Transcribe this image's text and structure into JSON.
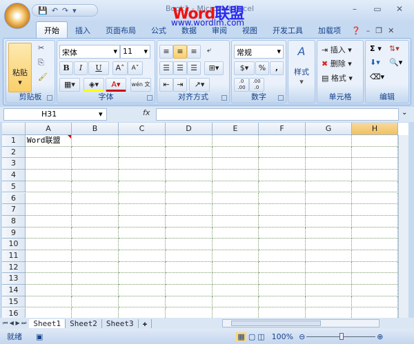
{
  "window": {
    "title": "Book1 - Microsoft Excel",
    "watermark_brand": "Word",
    "watermark_brand_cn": "联盟",
    "watermark_url": "www.wordlm.com"
  },
  "qat": {
    "save": "💾",
    "undo": "↶",
    "redo": "↷",
    "customize": "▾"
  },
  "tabs": [
    "开始",
    "插入",
    "页面布局",
    "公式",
    "数据",
    "审阅",
    "视图",
    "开发工具",
    "加载项"
  ],
  "ribbon": {
    "clipboard": {
      "label": "剪贴板",
      "paste": "粘贴"
    },
    "font": {
      "label": "字体",
      "name": "宋体",
      "size": "11",
      "bold": "B",
      "italic": "I",
      "underline": "U",
      "grow": "A˄",
      "shrink": "A˅",
      "phonetic": "wén 文"
    },
    "alignment": {
      "label": "对齐方式"
    },
    "number": {
      "label": "数字",
      "format": "常规",
      "percent": "%",
      "comma": ",",
      "inc_dec": ".0 .00",
      "dec_dec": ".00 .0"
    },
    "styles": {
      "label": "样式"
    },
    "cells": {
      "label": "单元格",
      "insert": "插入",
      "delete": "删除",
      "format": "格式"
    },
    "editing": {
      "label": "编辑",
      "sum": "Σ"
    }
  },
  "formula_bar": {
    "name_box": "H31",
    "fx": "fx",
    "value": ""
  },
  "columns": [
    "A",
    "B",
    "C",
    "D",
    "E",
    "F",
    "G",
    "H"
  ],
  "active_column": "H",
  "rows": [
    "1",
    "2",
    "3",
    "4",
    "5",
    "6",
    "7",
    "8",
    "9",
    "10",
    "11",
    "12",
    "13",
    "14",
    "15",
    "16"
  ],
  "cells": {
    "A1": "Word联盟"
  },
  "sheets": [
    "Sheet1",
    "Sheet2",
    "Sheet3"
  ],
  "active_sheet": "Sheet1",
  "status": {
    "text": "就绪",
    "zoom": "100%",
    "zoom_percent": 100
  }
}
